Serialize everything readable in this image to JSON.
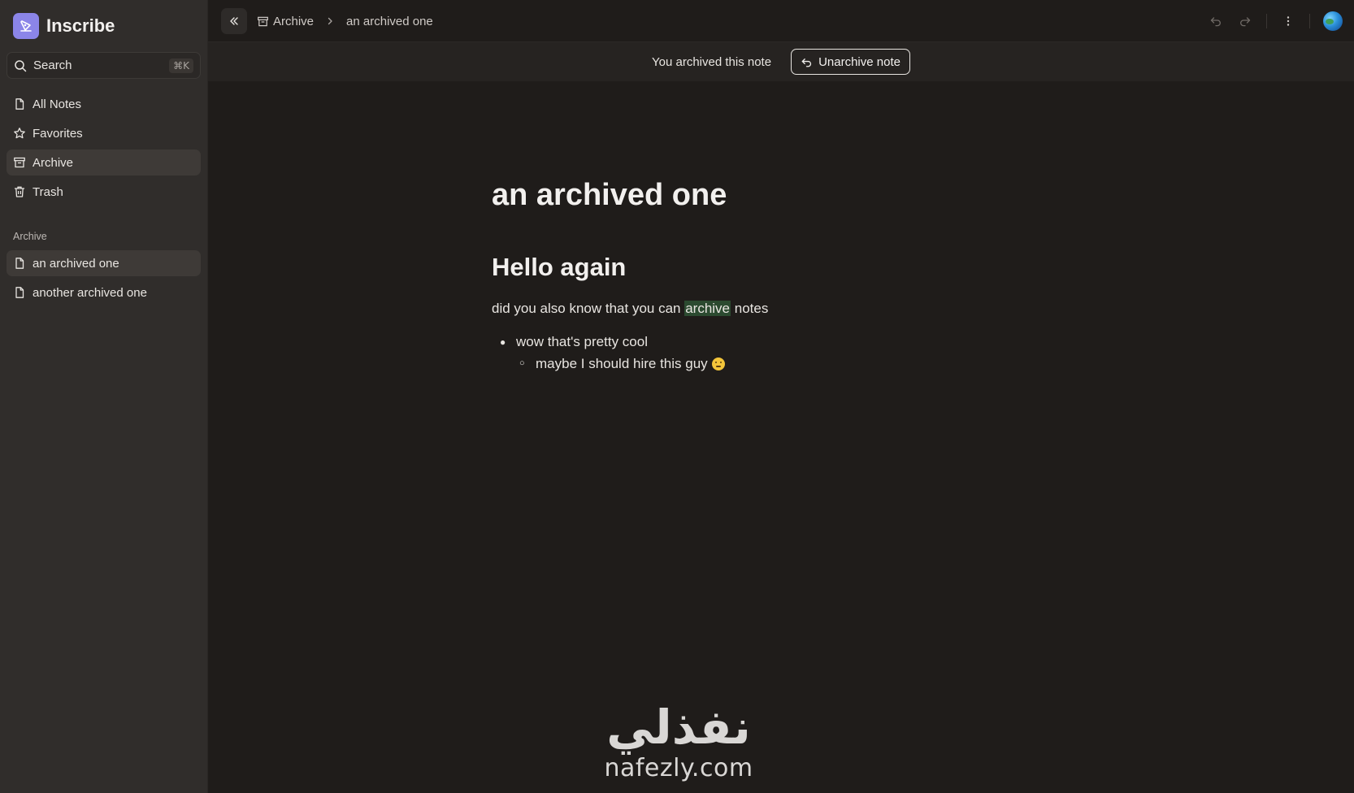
{
  "app": {
    "name": "Inscribe"
  },
  "search": {
    "label": "Search",
    "shortcut": "⌘K"
  },
  "nav": {
    "items": [
      {
        "label": "All Notes",
        "icon": "file-icon"
      },
      {
        "label": "Favorites",
        "icon": "star-icon"
      },
      {
        "label": "Archive",
        "icon": "archive-icon",
        "active": true
      },
      {
        "label": "Trash",
        "icon": "trash-icon"
      }
    ]
  },
  "archive_section": {
    "label": "Archive",
    "notes": [
      {
        "label": "an archived one",
        "active": true
      },
      {
        "label": "another archived one"
      }
    ]
  },
  "breadcrumb": {
    "section": "Archive",
    "current": "an archived one"
  },
  "banner": {
    "text": "You archived this note",
    "button": "Unarchive note"
  },
  "note": {
    "title": "an archived one",
    "heading": "Hello again",
    "paragraph": {
      "before": "did you also know that you can ",
      "highlight": "archive",
      "after": " notes"
    },
    "list": [
      {
        "text": "wow that's pretty cool"
      },
      {
        "text": "maybe I should hire this guy",
        "emoji": "thinking-face"
      }
    ]
  },
  "watermark": {
    "arabic": "نفذلي",
    "latin": "nafezly.com"
  },
  "colors": {
    "background": "#1f1c1a",
    "sidebar": "#302d2b",
    "banner": "#262321",
    "brand": "#8b85e8",
    "highlight": "#2b4a30"
  }
}
